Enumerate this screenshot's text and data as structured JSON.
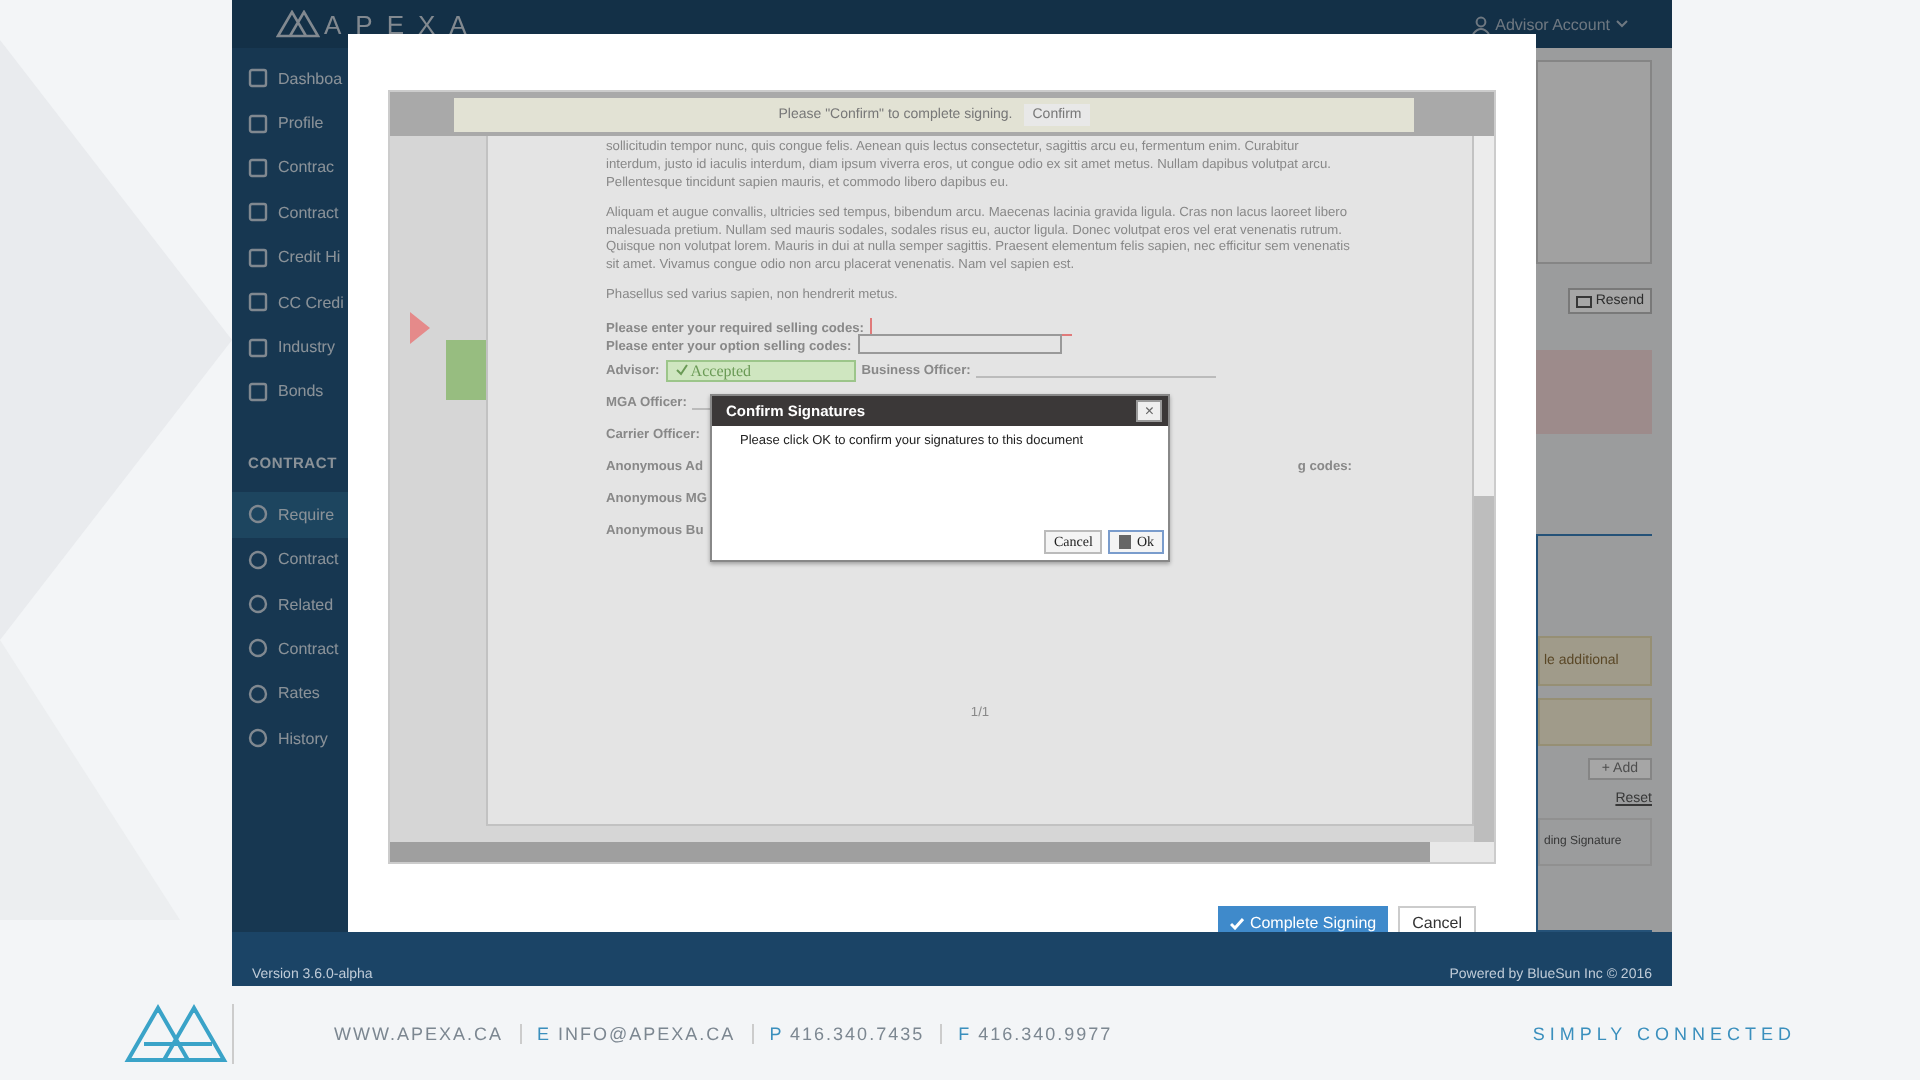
{
  "app": {
    "logo": "APEXA",
    "account": "Advisor Account",
    "sidebar": {
      "items": [
        {
          "label": "Dashboa",
          "selected": false
        },
        {
          "label": "Profile",
          "selected": false
        },
        {
          "label": "Contrac",
          "selected": false
        },
        {
          "label": "Contract",
          "selected": false
        },
        {
          "label": "Credit Hi",
          "selected": false
        },
        {
          "label": "CC Credi",
          "selected": false
        },
        {
          "label": "Industry",
          "selected": false
        },
        {
          "label": "Bonds",
          "selected": false
        }
      ],
      "section": "CONTRACT",
      "section_items": [
        {
          "label": "Require",
          "selected": true
        },
        {
          "label": "Contract",
          "selected": false
        },
        {
          "label": "Related",
          "selected": false
        },
        {
          "label": "Contract",
          "selected": false
        },
        {
          "label": "Rates",
          "selected": false
        },
        {
          "label": "History",
          "selected": false
        }
      ]
    },
    "right_panel": {
      "resend": "Resend",
      "notice": "le additional",
      "add": "+ Add",
      "reset": "Reset",
      "status": "ding Signature"
    },
    "footer": {
      "version": "Version 3.6.0-alpha",
      "powered": "Powered by BlueSun Inc © 2016"
    }
  },
  "modal": {
    "banner": {
      "text": "Please \"Confirm\" to complete signing.",
      "button": "Confirm"
    },
    "paragraphs": [
      "sollicitudin tempor nunc, quis congue felis. Aenean quis lectus consectetur, sagittis arcu eu, fermentum enim. Curabitur interdum, justo id iaculis interdum, diam ipsum viverra eros, ut congue odio ex sit amet metus. Nullam dapibus volutpat arcu. Pellentesque tincidunt sapien mauris, et commodo libero dapibus eu.",
      "Aliquam et augue convallis, ultricies sed tempus, bibendum arcu. Maecenas lacinia gravida ligula. Cras non lacus laoreet libero malesuada pretium. Nullam sed mauris sodales, sodales risus eu, auctor ligula. Donec volutpat eros vel erat venenatis rutrum. Quisque non volutpat lorem. Mauris in dui at nulla semper sagittis. Praesent elementum felis sapien, nec efficitur sem venenatis sit amet. Vivamus congue odio non arcu placerat venenatis. Nam vel sapien est.",
      "Phasellus sed varius sapien, non hendrerit metus."
    ],
    "required_codes": "Please enter your required selling codes:",
    "option_codes": "Please enter your option selling codes:",
    "advisor": {
      "label": "Advisor:",
      "value": "Accepted"
    },
    "business_officer": "Business Officer:",
    "mga_officer": "MGA Officer:",
    "carrier_officer": "Carrier Officer:",
    "anonymous_rows": [
      "Anonymous Ad",
      "Anonymous MG",
      "Anonymous Bu"
    ],
    "anonymous_right": "g codes:",
    "page_number": "1/1",
    "dialog": {
      "title": "Confirm Signatures",
      "close": "×",
      "message": "Please click OK to confirm your signatures to this document",
      "cancel": "Cancel",
      "ok": "Ok"
    },
    "complete": "Complete Signing",
    "cancel": "Cancel"
  },
  "slide_footer": {
    "website": "WWW.APEXA.CA",
    "email_prefix": "E",
    "email": "INFO@APEXA.CA",
    "phone_prefix": "P",
    "phone": "416.340.7435",
    "fax_prefix": "F",
    "fax": "416.340.9977",
    "tagline": "SIMPLY CONNECTED"
  }
}
